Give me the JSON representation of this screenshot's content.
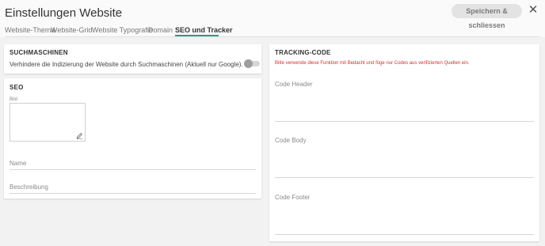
{
  "window": {
    "title": "Einstellungen Website",
    "save_label": "Speichern & schliessen",
    "close_glyph": "✕",
    "close_icon": "close-icon"
  },
  "tabs": [
    {
      "label": "Website-Thema",
      "active": false
    },
    {
      "label": "Website-Grid",
      "active": false
    },
    {
      "label": "Website Typografie",
      "active": false
    },
    {
      "label": "Domain",
      "active": false
    },
    {
      "label": "SEO und Tracker",
      "active": true
    }
  ],
  "suchmaschinen": {
    "title": "SUCHMASCHINEN",
    "option_label": "Verhindere die Indizierung der Website durch Suchmaschinen (Aktuell nur Google).",
    "toggle_on": false
  },
  "seo": {
    "title": "SEO",
    "image_label": "Bild",
    "edit_icon": "pencil-icon",
    "name_placeholder": "Name",
    "description_placeholder": "Beschreibung"
  },
  "tracking": {
    "title": "TRACKING-CODE",
    "warning": "Bitte verwende diese Funktion mit Bedacht und füge nur Codes aus verifizierten Quellen ein.",
    "header_label": "Code Header",
    "body_label": "Code Body",
    "footer_label": "Code Footer"
  },
  "colors": {
    "accent": "#2c9a8a",
    "warning": "#d32f2f"
  }
}
